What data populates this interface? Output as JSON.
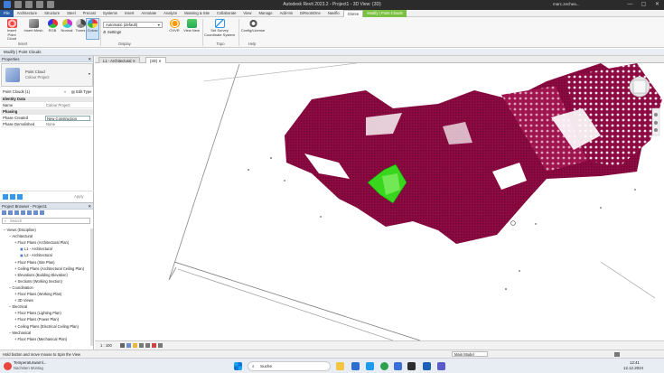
{
  "window": {
    "title": "Autodesk Revit 2023.2 - Project1 - 3D View: {3D}",
    "user": "marc.zechea...",
    "controls": [
      "—",
      "▢",
      "✕"
    ]
  },
  "tabs": [
    "File",
    "Architecture",
    "Structure",
    "Steel",
    "Precast",
    "Systems",
    "Insert",
    "Annotate",
    "Analyze",
    "Massing & Site",
    "Collaborate",
    "View",
    "Manage",
    "Add-Ins",
    "DiRootsOne",
    "Naviflo",
    "Gloree",
    "Modify | Point Clouds"
  ],
  "active_tab": "Gloree",
  "ribbon": {
    "insert_point_cloud": "Insert\nPoint Cloud",
    "insert_mesh": "Insert Mesh",
    "rgb": "RGB",
    "normal": "Normal",
    "tones": "Tones",
    "colour": "Colour",
    "display_dropdown": "Automatic (default)",
    "settings": "Settings",
    "ovvr": "OVVR",
    "view_new": "View New",
    "set_survey": "Set Survey\nCoordinate System",
    "config_license": "Config/License",
    "groups": [
      "Insert",
      "Display",
      "Topo",
      "Help"
    ]
  },
  "modebar": "Modify | Point Clouds",
  "properties": {
    "header": "Properties",
    "type_name": "Point Cloud",
    "type_sub": "Colour Project",
    "selector": "Point Clouds (1)",
    "edit_type": "Edit Type",
    "rows": [
      {
        "k": "Identity Data",
        "v": "",
        "cat": true
      },
      {
        "k": "Name",
        "v": "Colour Project",
        "cat": false
      },
      {
        "k": "Phasing",
        "v": "",
        "cat": true
      },
      {
        "k": "Phase Created",
        "v": "New Construction",
        "cat": false,
        "box": true
      },
      {
        "k": "Phase Demolished",
        "v": "None",
        "cat": false
      }
    ],
    "apply": "Apply"
  },
  "project_browser": {
    "header": "Project Browser - Project1",
    "search_placeholder": "Search",
    "items": [
      {
        "t": "Views (Discipline)",
        "d": 0
      },
      {
        "t": "Architectural",
        "d": 1
      },
      {
        "t": "Floor Plans (Architectural Plan)",
        "d": 2
      },
      {
        "t": "L1 - Architectural",
        "d": 3
      },
      {
        "t": "L2 - Architectural",
        "d": 3
      },
      {
        "t": "Floor Plans (Site Plan)",
        "d": 2
      },
      {
        "t": "Ceiling Plans (Architectural Ceiling Plan)",
        "d": 2
      },
      {
        "t": "Elevations (Building Elevation)",
        "d": 2
      },
      {
        "t": "Sections (Working Section)",
        "d": 2
      },
      {
        "t": "Coordination",
        "d": 1
      },
      {
        "t": "Floor Plans (Working Plan)",
        "d": 2
      },
      {
        "t": "3D Views",
        "d": 2
      },
      {
        "t": "Electrical",
        "d": 1
      },
      {
        "t": "Floor Plans (Lighting Plan)",
        "d": 2
      },
      {
        "t": "Floor Plans (Power Plan)",
        "d": 2
      },
      {
        "t": "Ceiling Plans (Electrical Ceiling Plan)",
        "d": 2
      },
      {
        "t": "Mechanical",
        "d": 1
      },
      {
        "t": "Floor Plans (Mechanical Plan)",
        "d": 2
      }
    ]
  },
  "view_tabs": [
    {
      "label": "L1 - Architectural",
      "active": false
    },
    {
      "label": "{3D}",
      "active": true
    }
  ],
  "view_control_bar": {
    "scale": "1 : 100"
  },
  "statusbar": {
    "hint": "Hold button and move mouse to Spin the View",
    "model": "Main Model"
  },
  "taskbar": {
    "weather_title": "Temperaturwarnl...",
    "weather_sub": "Nachsten Montag",
    "search": "Suche",
    "time": "12:41",
    "date": "12.12.2024"
  },
  "colors": {
    "pointcloud": "#8e0a42",
    "selected": "#38d61c",
    "file_tab": "#2a5ea8",
    "context_tab": "#7ac142"
  }
}
